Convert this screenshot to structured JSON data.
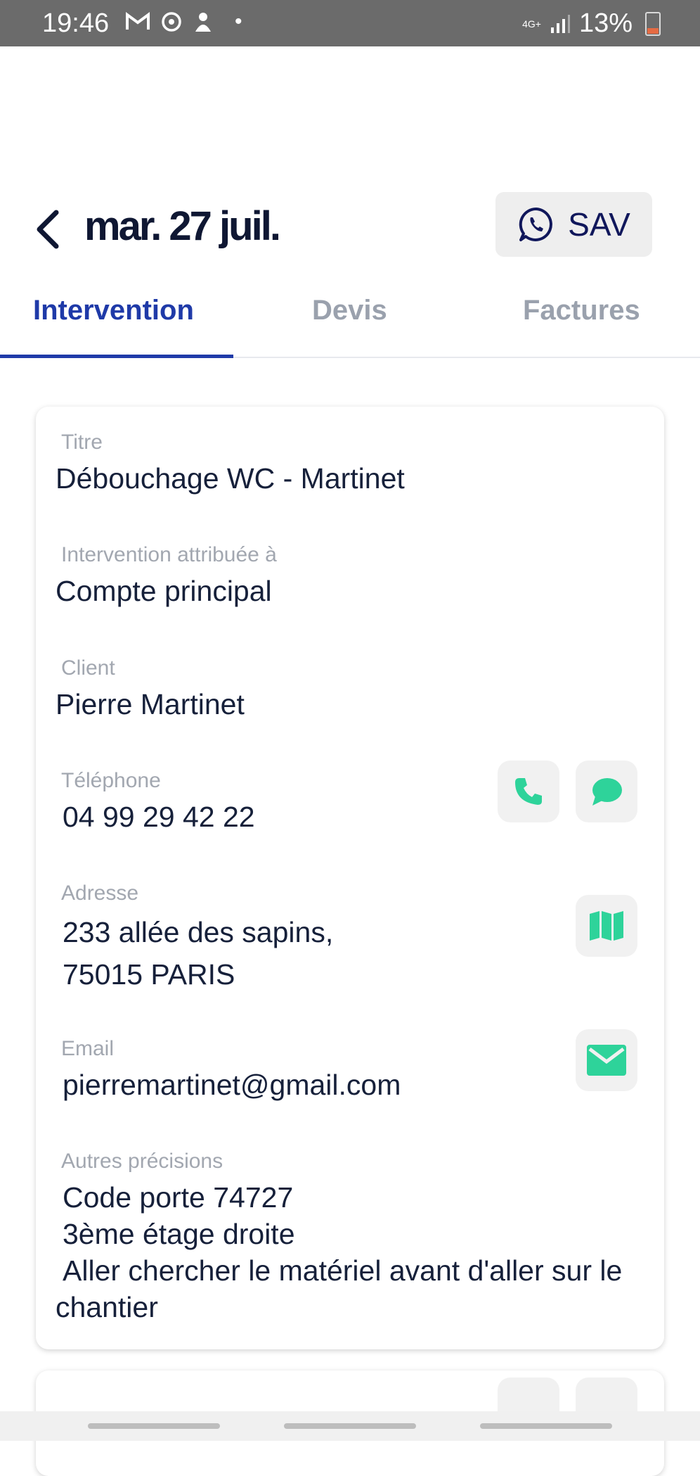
{
  "status_bar": {
    "time": "19:46",
    "network": "4G+",
    "battery": "13%",
    "icons": [
      "gmail-icon",
      "sync-icon",
      "notification-icon",
      "dot-icon",
      "signal-icon",
      "battery-icon"
    ]
  },
  "header": {
    "title": "mar. 27 juil.",
    "sav_label": "SAV"
  },
  "tabs": [
    {
      "label": "Intervention",
      "active": true
    },
    {
      "label": "Devis",
      "active": false
    },
    {
      "label": "Factures",
      "active": false
    }
  ],
  "details": {
    "titre": {
      "label": "Titre",
      "value": "Débouchage WC - Martinet"
    },
    "attribuee": {
      "label": "Intervention attribuée à",
      "value": "Compte principal"
    },
    "client": {
      "label": "Client",
      "value": "Pierre Martinet"
    },
    "telephone": {
      "label": "Téléphone",
      "value": "04 99 29 42 22"
    },
    "adresse": {
      "label": "Adresse",
      "value": "233 allée des sapins,\n75015 PARIS"
    },
    "email": {
      "label": "Email",
      "value": "pierremartinet@gmail.com"
    },
    "precisions": {
      "label": "Autres précisions",
      "line1": "Code porte 74727",
      "line2": "3ème étage droite",
      "line3": "Aller chercher le matériel avant d'aller sur le",
      "line4": "chantier"
    }
  },
  "colors": {
    "accent": "#1f3aa8",
    "action_green": "#2ed39a",
    "title_navy": "#0f1733"
  }
}
